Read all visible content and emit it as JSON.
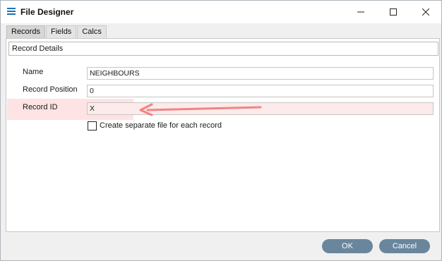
{
  "window": {
    "title": "File Designer",
    "app_icon": "list-icon",
    "controls": [
      "minimize-icon",
      "maximize-icon",
      "close-icon"
    ]
  },
  "tabs": [
    {
      "label": "Records",
      "active": true
    },
    {
      "label": "Fields",
      "active": false
    },
    {
      "label": "Calcs",
      "active": false
    }
  ],
  "section": {
    "header": "Record Details"
  },
  "form": {
    "name": {
      "label": "Name",
      "value": "NEIGHBOURS"
    },
    "record_position": {
      "label": "Record Position",
      "value": "0"
    },
    "record_id": {
      "label": "Record ID",
      "value": "X"
    },
    "separate_file": {
      "label": "Create separate file for each record",
      "checked": false
    }
  },
  "annotation": {
    "highlight_color": "#fde3e3",
    "arrow_color": "#f08585"
  },
  "buttons": {
    "ok": "OK",
    "cancel": "Cancel"
  },
  "colors": {
    "button_bg": "#69869c",
    "accent": "#1e6fb8"
  }
}
